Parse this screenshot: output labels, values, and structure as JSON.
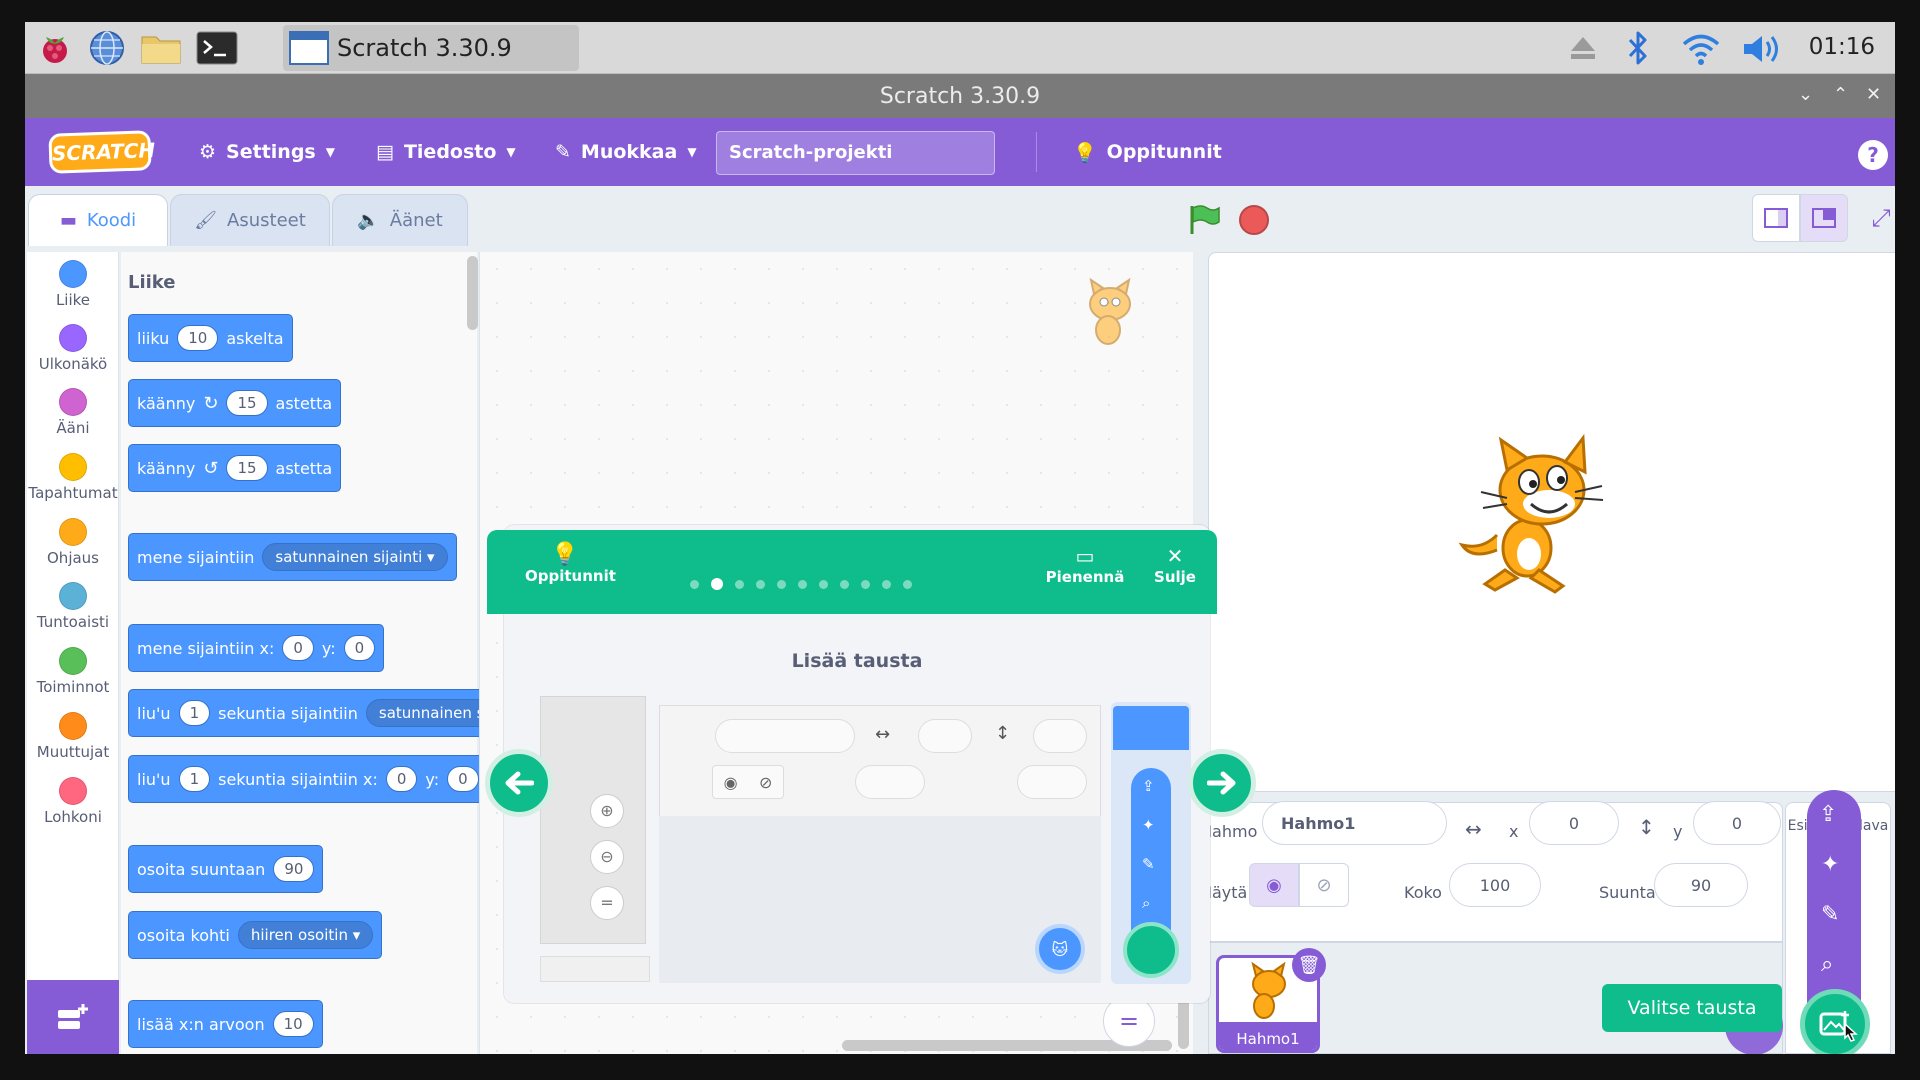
{
  "taskbar": {
    "icons": [
      "raspberry-icon",
      "globe-icon",
      "folder-icon",
      "terminal-icon"
    ],
    "task_label": "Scratch 3.30.9",
    "clock": "01:16",
    "tray_icons": [
      "eject-icon",
      "bluetooth-icon",
      "wifi-icon",
      "volume-icon"
    ]
  },
  "window": {
    "title": "Scratch 3.30.9"
  },
  "menubar": {
    "logo": "SCRATCH",
    "settings": "Settings",
    "file": "Tiedosto",
    "edit": "Muokkaa",
    "project_title": "Scratch-projekti",
    "tutorials": "Oppitunnit",
    "help": "?"
  },
  "tabs": {
    "code": "Koodi",
    "costumes": "Asusteet",
    "sounds": "Äänet"
  },
  "categories": [
    {
      "label": "Liike",
      "color": "#4c97ff"
    },
    {
      "label": "Ulkonäkö",
      "color": "#9966ff"
    },
    {
      "label": "Ääni",
      "color": "#cf63cf"
    },
    {
      "label": "Tapahtumat",
      "color": "#ffbf00"
    },
    {
      "label": "Ohjaus",
      "color": "#ffab19"
    },
    {
      "label": "Tuntoaisti",
      "color": "#5cb1d6"
    },
    {
      "label": "Toiminnot",
      "color": "#59c059"
    },
    {
      "label": "Muuttujat",
      "color": "#ff8c1a"
    },
    {
      "label": "Lohkoni",
      "color": "#ff6680"
    }
  ],
  "palette": {
    "heading": "Liike",
    "b1": {
      "a": "liiku",
      "v": "10",
      "b": "askelta"
    },
    "b2": {
      "a": "käänny",
      "v": "15",
      "b": "astetta"
    },
    "b3": {
      "a": "käänny",
      "v": "15",
      "b": "astetta"
    },
    "b4": {
      "a": "mene sijaintiin",
      "d": "satunnainen sijainti"
    },
    "b5": {
      "a": "mene sijaintiin x:",
      "x": "0",
      "y_label": "y:",
      "y": "0"
    },
    "b6": {
      "a": "liu'u",
      "v": "1",
      "b": "sekuntia sijaintiin",
      "d": "satunnainen sijai"
    },
    "b7": {
      "a": "liu'u",
      "v": "1",
      "b": "sekuntia sijaintiin x:",
      "x": "0",
      "y_label": "y:",
      "y": "0"
    },
    "b8": {
      "a": "osoita suuntaan",
      "v": "90"
    },
    "b9": {
      "a": "osoita kohti",
      "d": "hiiren osoitin"
    },
    "b10": {
      "a": "lisää x:n arvoon",
      "v": "10"
    }
  },
  "tutorial": {
    "label": "Oppitunnit",
    "title": "Lisää tausta",
    "shrink": "Pienennä",
    "close": "Sulje",
    "steps_total": 11,
    "current_step": 2
  },
  "sprite_info": {
    "sprite_label": "Hahmo",
    "sprite_name": "Hahmo1",
    "x_label": "x",
    "x": "0",
    "y_label": "y",
    "y": "0",
    "show_label": "Näytä",
    "size_label": "Koko",
    "size": "100",
    "direction_label": "Suunta",
    "direction": "90"
  },
  "sprite_list": [
    {
      "name": "Hahmo1"
    }
  ],
  "stage_panel": {
    "label": "Esiintymislava"
  },
  "tooltip": {
    "choose_backdrop": "Valitse tausta"
  }
}
